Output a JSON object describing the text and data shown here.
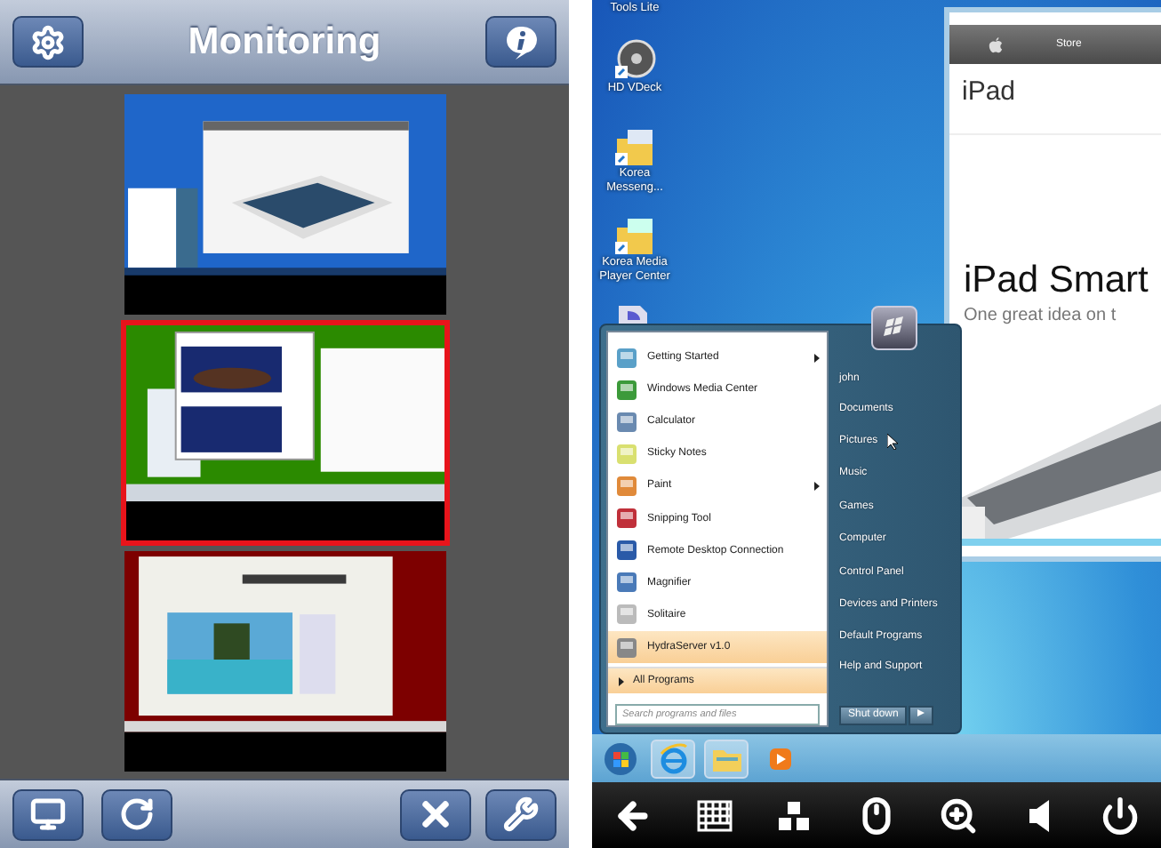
{
  "monitoring_app": {
    "title": "Monitoring",
    "thumbnails": [
      {
        "kind": "picture",
        "selected": false
      },
      {
        "kind": "picture",
        "selected": true
      },
      {
        "kind": "picture",
        "selected": false
      }
    ]
  },
  "remote_desktop": {
    "desktop_icons": [
      {
        "label": "Tools Lite"
      },
      {
        "label": "HD VDeck"
      },
      {
        "label": "Korea Messeng..."
      },
      {
        "label": "Korea Media Player Center"
      }
    ],
    "browser": {
      "nav_item": "Store",
      "page_title": "iPad",
      "headline": "iPad Smart",
      "subheadline": "One great idea on t"
    },
    "start_menu": {
      "programs": [
        {
          "label": "Getting Started",
          "submenu": true,
          "highlighted": false
        },
        {
          "label": "Windows Media Center",
          "submenu": false,
          "highlighted": false
        },
        {
          "label": "Calculator",
          "submenu": false,
          "highlighted": false
        },
        {
          "label": "Sticky Notes",
          "submenu": false,
          "highlighted": false
        },
        {
          "label": "Paint",
          "submenu": true,
          "highlighted": false
        },
        {
          "label": "Snipping Tool",
          "submenu": false,
          "highlighted": false
        },
        {
          "label": "Remote Desktop Connection",
          "submenu": false,
          "highlighted": false
        },
        {
          "label": "Magnifier",
          "submenu": false,
          "highlighted": false
        },
        {
          "label": "Solitaire",
          "submenu": false,
          "highlighted": false
        },
        {
          "label": "HydraServer v1.0",
          "submenu": false,
          "highlighted": true
        }
      ],
      "all_programs": "All Programs",
      "search": {
        "placeholder": "Search programs and files"
      },
      "places": [
        "john",
        "Documents",
        "Pictures",
        "Music",
        "Games",
        "Computer",
        "Control Panel",
        "Devices and Printers",
        "Default Programs",
        "Help and Support"
      ],
      "shutdown": "Shut down"
    }
  }
}
